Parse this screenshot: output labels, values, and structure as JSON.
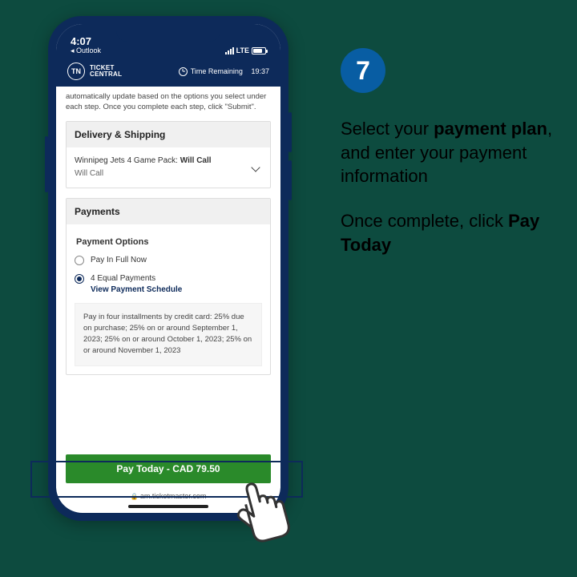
{
  "step_number": "7",
  "instructions": {
    "line1_pre": "Select your ",
    "line1_bold": "payment plan",
    "line1_post": ", and enter your payment information",
    "line2_pre": "Once complete, click ",
    "line2_bold": "Pay Today"
  },
  "status": {
    "time": "4:07",
    "back_label": "◂ Outlook",
    "network_label": "LTE"
  },
  "header": {
    "brand_initials": "TN",
    "brand_line1": "TICKET",
    "brand_line2": "CENTRAL",
    "time_remaining_label": "Time Remaining",
    "time_remaining_value": "19:37"
  },
  "content": {
    "intro_text": "automatically update based on the options you select under each step. Once you complete each step, click \"Submit\".",
    "delivery": {
      "title": "Delivery & Shipping",
      "item_prefix": "Winnipeg Jets 4 Game Pack: ",
      "item_value": "Will Call",
      "sub_value": "Will Call"
    },
    "payments": {
      "title": "Payments",
      "options_title": "Payment Options",
      "option1_label": "Pay In Full Now",
      "option2_label": "4 Equal Payments",
      "view_schedule_label": "View Payment Schedule",
      "info_text": "Pay in four installments by credit card: 25% due on purchase; 25% on or around September 1, 2023; 25% on or around October 1, 2023; 25% on or around November 1, 2023"
    }
  },
  "footer": {
    "pay_today_label": "Pay Today - CAD 79.50",
    "url": "am.ticketmaster.com"
  }
}
